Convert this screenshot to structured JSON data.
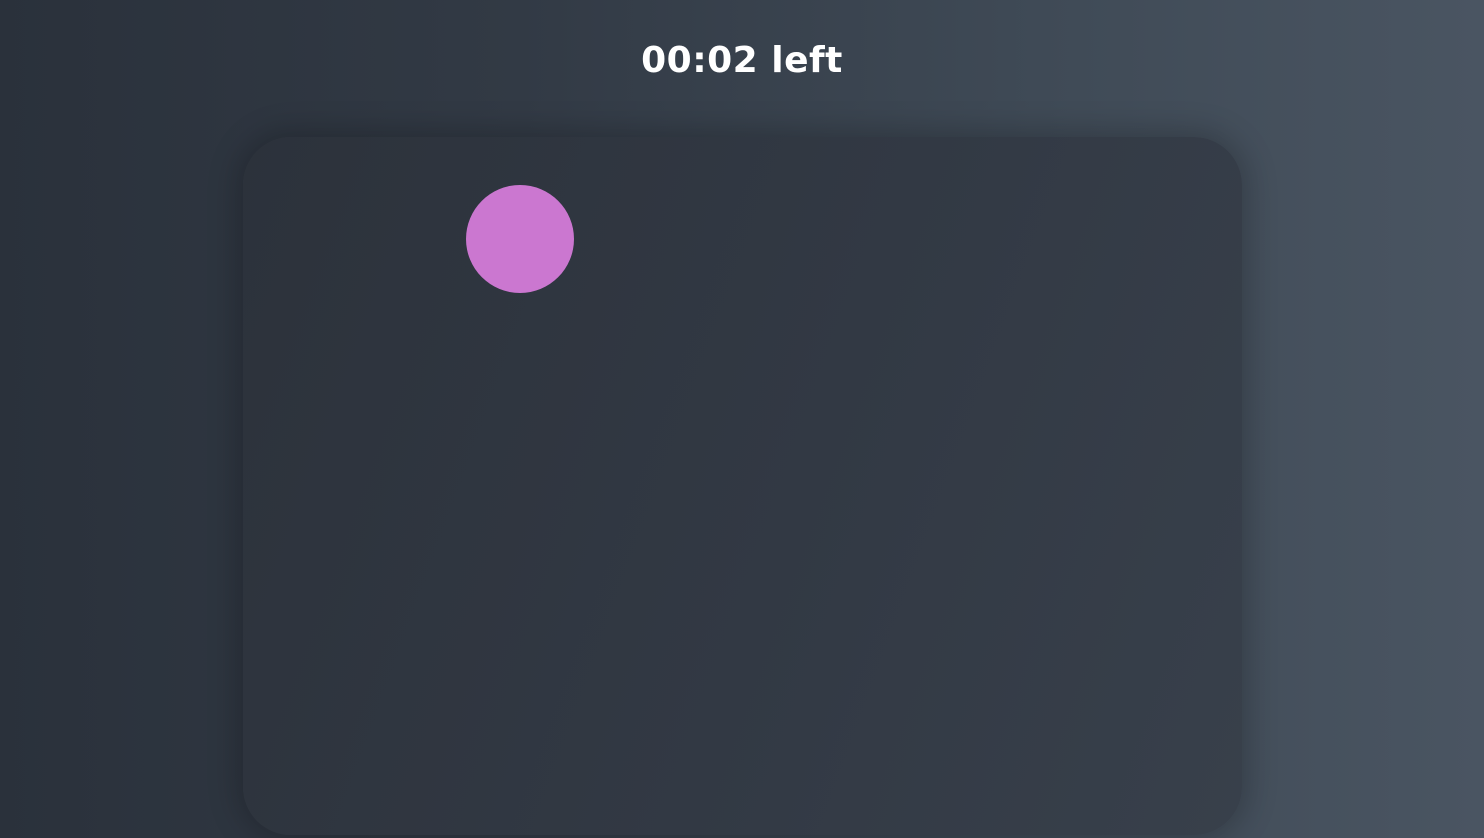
{
  "timer": {
    "label": "00:02 left"
  },
  "arena": {
    "target": {
      "icon": "circle-target",
      "color": "#cb77d0"
    }
  }
}
